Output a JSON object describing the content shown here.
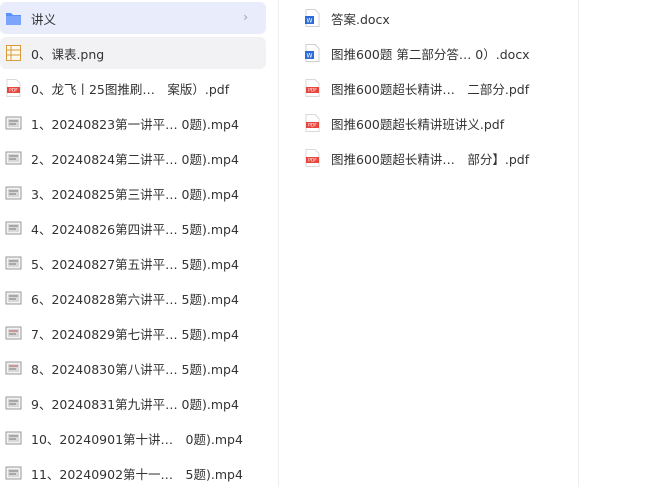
{
  "left_panel": {
    "items": [
      {
        "label": "讲义",
        "icon": "folder-icon",
        "state": "selected"
      },
      {
        "label": "0、课表.png",
        "icon": "image-file-icon",
        "state": "hover"
      },
      {
        "label": "0、龙飞丨25图推刷…　案版）.pdf",
        "icon": "pdf-file-icon",
        "state": ""
      },
      {
        "label": "1、20240823第一讲平… 0题).mp4",
        "icon": "video-file-icon",
        "state": ""
      },
      {
        "label": "2、20240824第二讲平… 0题).mp4",
        "icon": "video-file-icon",
        "state": ""
      },
      {
        "label": "3、20240825第三讲平… 0题).mp4",
        "icon": "video-file-icon",
        "state": ""
      },
      {
        "label": "4、20240826第四讲平… 5题).mp4",
        "icon": "video-file-icon",
        "state": ""
      },
      {
        "label": "5、20240827第五讲平… 5题).mp4",
        "icon": "video-file-icon",
        "state": ""
      },
      {
        "label": "6、20240828第六讲平… 5题).mp4",
        "icon": "video-file-icon",
        "state": ""
      },
      {
        "label": "7、20240829第七讲平… 5题).mp4",
        "icon": "video-file-icon",
        "state": ""
      },
      {
        "label": "8、20240830第八讲平… 5题).mp4",
        "icon": "video-file-icon",
        "state": ""
      },
      {
        "label": "9、20240831第九讲平… 0题).mp4",
        "icon": "video-file-icon",
        "state": ""
      },
      {
        "label": "10、20240901第十讲…　0题).mp4",
        "icon": "video-file-icon",
        "state": ""
      },
      {
        "label": "11、20240902第十一…　5题).mp4",
        "icon": "video-file-icon",
        "state": ""
      }
    ],
    "folder_chevron": "›"
  },
  "right_panel": {
    "items": [
      {
        "label": "答案.docx",
        "icon": "word-file-icon"
      },
      {
        "label": "图推600题 第二部分答… 0）.docx",
        "icon": "word-file-icon"
      },
      {
        "label": "图推600题超长精讲…　二部分.pdf",
        "icon": "pdf-file-icon"
      },
      {
        "label": "图推600题超长精讲班讲义.pdf",
        "icon": "pdf-file-icon"
      },
      {
        "label": "图推600题超长精讲…　部分】.pdf",
        "icon": "pdf-file-icon"
      }
    ]
  },
  "colors": {
    "selected_bg": "#e9edfb",
    "folder": "#5b8ff9",
    "pdf": "#e8453c",
    "word": "#2b6ad9"
  }
}
